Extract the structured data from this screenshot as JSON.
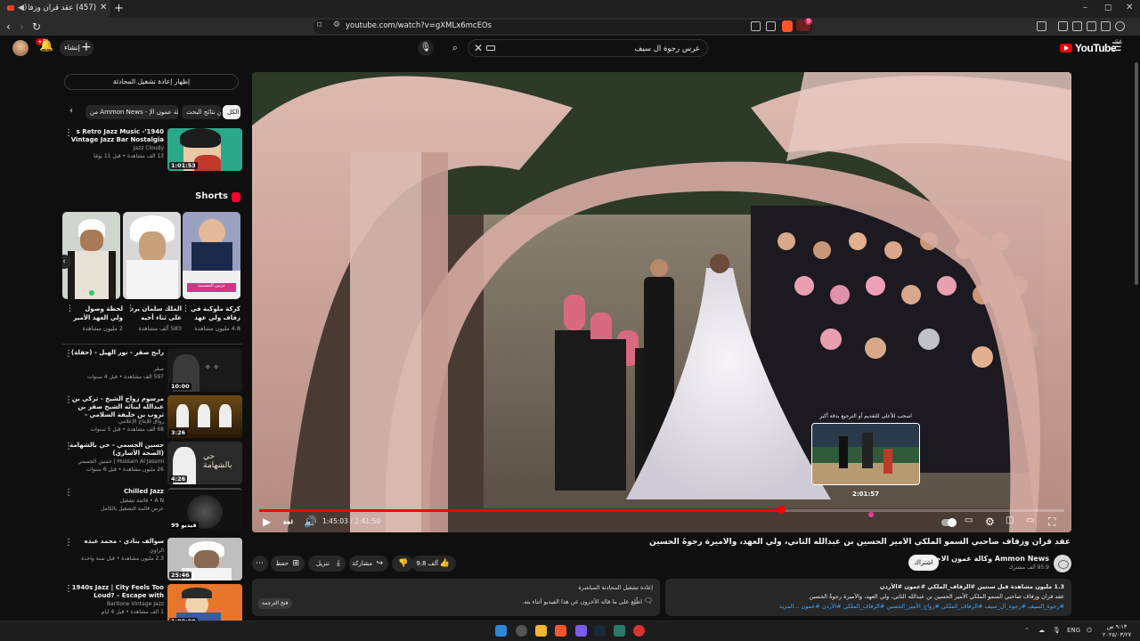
{
  "browser": {
    "tab_title": "(457) عقد قران وزفاف صاحبي",
    "url": "youtube.com/watch?v=gXMLx6mcEOs",
    "ext_badge": "9"
  },
  "header": {
    "create_label": "إنشاء",
    "notif_count": "+9",
    "search_value": "عرس رجوة ال سيف",
    "logo_text": "YouTube",
    "region": "SA"
  },
  "sidebar": {
    "live_chat_toggle": "إظهار إعادة تشغيل المحادثة",
    "chips": [
      "الكل",
      "من نتائج البحث",
      "من Ammon News - وكالة عمون الإ"
    ],
    "videos_top": [
      {
        "title": "1940's Retro Jazz Music - Vintage Jazz Bar Nostalgia",
        "channel": "Jazz Cloudy",
        "meta": "13 ألف مشاهدة • قبل 11 يومًا",
        "duration": "1:01:53"
      }
    ],
    "shorts_title": "Shorts",
    "shorts": [
      {
        "title": "كركة ملوكية في زفاف ولي عهد",
        "views": "4.8 مليون مشاهدة"
      },
      {
        "title": "الملك سلمان يرد على ثناء أخيه",
        "views": "583 ألف مشاهدة"
      },
      {
        "title": "لحظة وصول ولي العهد الأمير محمد",
        "views": "2 مليون مشاهدة"
      }
    ],
    "short_badge": "عرس الحسينية",
    "videos": [
      {
        "title": "رابح صقر - نور الهيل - (حفلة)",
        "channel": "صقر",
        "meta": "597 ألف مشاهدة • قبل 4 سنوات",
        "duration": "10:00"
      },
      {
        "title": "مرسوم زواج الشيخ - تركي بن عبدالله لبنائه الشيخ صقر بن ثروب بن خليفة السلامي - قاعي",
        "channel": "رواق للإنتاج الإعلامي",
        "meta": "68 ألف مشاهدة • قبل 5 سنوات",
        "duration": "3:26"
      },
      {
        "title": "حسين الجسمي - حي بالشهامة (الصحة الأساري)",
        "channel": "Hussain Al Jassmi | حسين الجسمي",
        "meta": "26 مليون مشاهدة • قبل 6 سنوات",
        "duration": "4:26"
      },
      {
        "title": "Chilled Jazz",
        "channel": "A N • قائمة تشغيل",
        "meta": "عرض قائمة التشغيل بالكامل",
        "duration": "99 فيديو"
      },
      {
        "title": "سوالف بنادي - محمد عبده",
        "channel": "الراوي",
        "meta": "2.3 مليون مشاهدة • قبل سنة واحدة",
        "duration": "25:46"
      },
      {
        "title": "1940s Jazz | City Feels Too Loud? – Escape with Classic",
        "channel": "Baritone Vintage Jazz",
        "meta": "1 ألف مشاهدة • قبل 4 أيام",
        "duration": "1:00:00"
      }
    ]
  },
  "player": {
    "current_time": "1:45:03",
    "duration": "2:41:50",
    "time_display": "1:45:03 / 2:41:50",
    "progress": 0.649,
    "hover_progress": 0.76,
    "preview_caption": "اسحب للأعلى للتقديم أو الترجيع بدقة أكبر",
    "preview_time": "2:01:57"
  },
  "video": {
    "title": "عقد قران وزفاف صاحبي السمو الملكي الأمير الحسين بن عبدالله الثاني، ولي العهد، والأميرة رجوةُ الحسين",
    "channel_name": "Ammon News وكالة عمون الاخبارية",
    "subscribers": "95.9 ألف مشترك",
    "subscribe_label": "اشتراك",
    "likes": "9.8 آلف",
    "share_label": "مشاركة",
    "download_label": "تنزيل",
    "save_label": "حفظ",
    "description": {
      "line1": "1.3 مليون مشاهدة  قبل سنتين  #الزفاف_الملكي  #عمون  #الأردن",
      "line2": "عقد قران وزفاف صاحبي السمو الملكي الأمير الحسين بن عبدالله الثاني، ولي العهد، والأميرة رجوةُ الحسين",
      "line3": "#رجوة_السيف #رجوة_آل_سيف #الزفاف_الملكي #زواج_الأمير_الحسين #الزفاف_الملكي #الأردن #عمون ...المزيد"
    },
    "live_chat": {
      "heading": "إعادة تشغيل المحادثة المباشرة",
      "subtitle": "اطّلِع على ما قاله الآخرون عن هذا الفيديو أثناء بثه.",
      "button": "فتح الترجمة"
    }
  },
  "taskbar": {
    "lang": "ENG",
    "time": "٩:١٣ ص",
    "date": "٢٠٢٥/٠٣/٢٧"
  }
}
